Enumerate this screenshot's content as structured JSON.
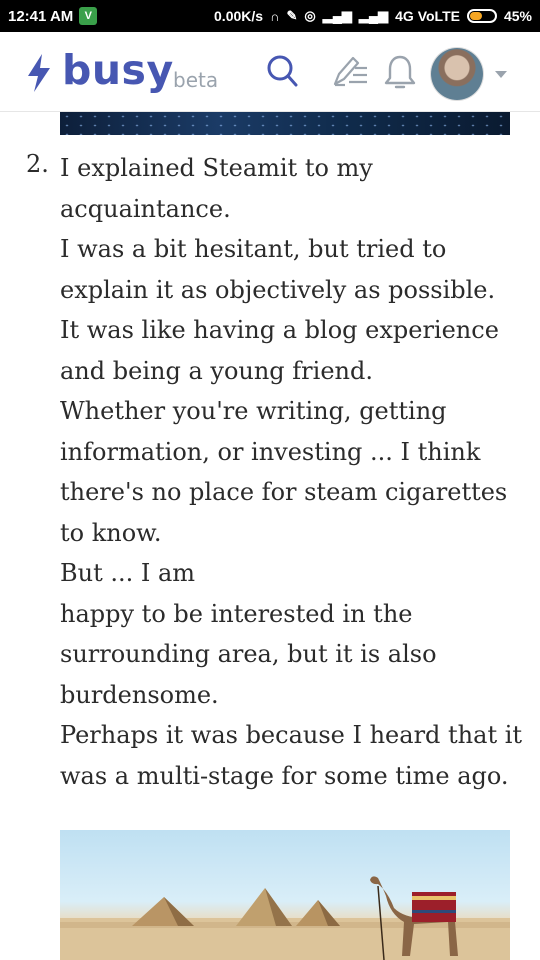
{
  "status_bar": {
    "time": "12:41 AM",
    "app_badge": "V",
    "speed": "0.00K/s",
    "network": "4G VoLTE",
    "battery_level": 45,
    "battery_text": "45%"
  },
  "header": {
    "logo_text": "busy",
    "beta_label": "beta",
    "brand_color": "#4757b2",
    "icons": [
      "bolt-icon",
      "search-icon",
      "write-icon",
      "bell-icon",
      "avatar",
      "chevron-down-icon"
    ]
  },
  "article": {
    "list_number": "2.",
    "lines": [
      "I explained Steamit to my",
      "acquaintance.",
      "I was a bit hesitant, but tried to",
      "explain it as objectively as possible.",
      "It was like having a blog experience",
      "and being a young friend.",
      "Whether you're writing, getting",
      "information, or investing ... I think",
      "there's no place for steam cigarettes",
      "to know.",
      "But ... I am",
      "happy to be interested in the",
      "surrounding area, but it is also",
      "burdensome.",
      "Perhaps it was because I heard that it",
      "was a multi-stage for some time ago."
    ]
  }
}
